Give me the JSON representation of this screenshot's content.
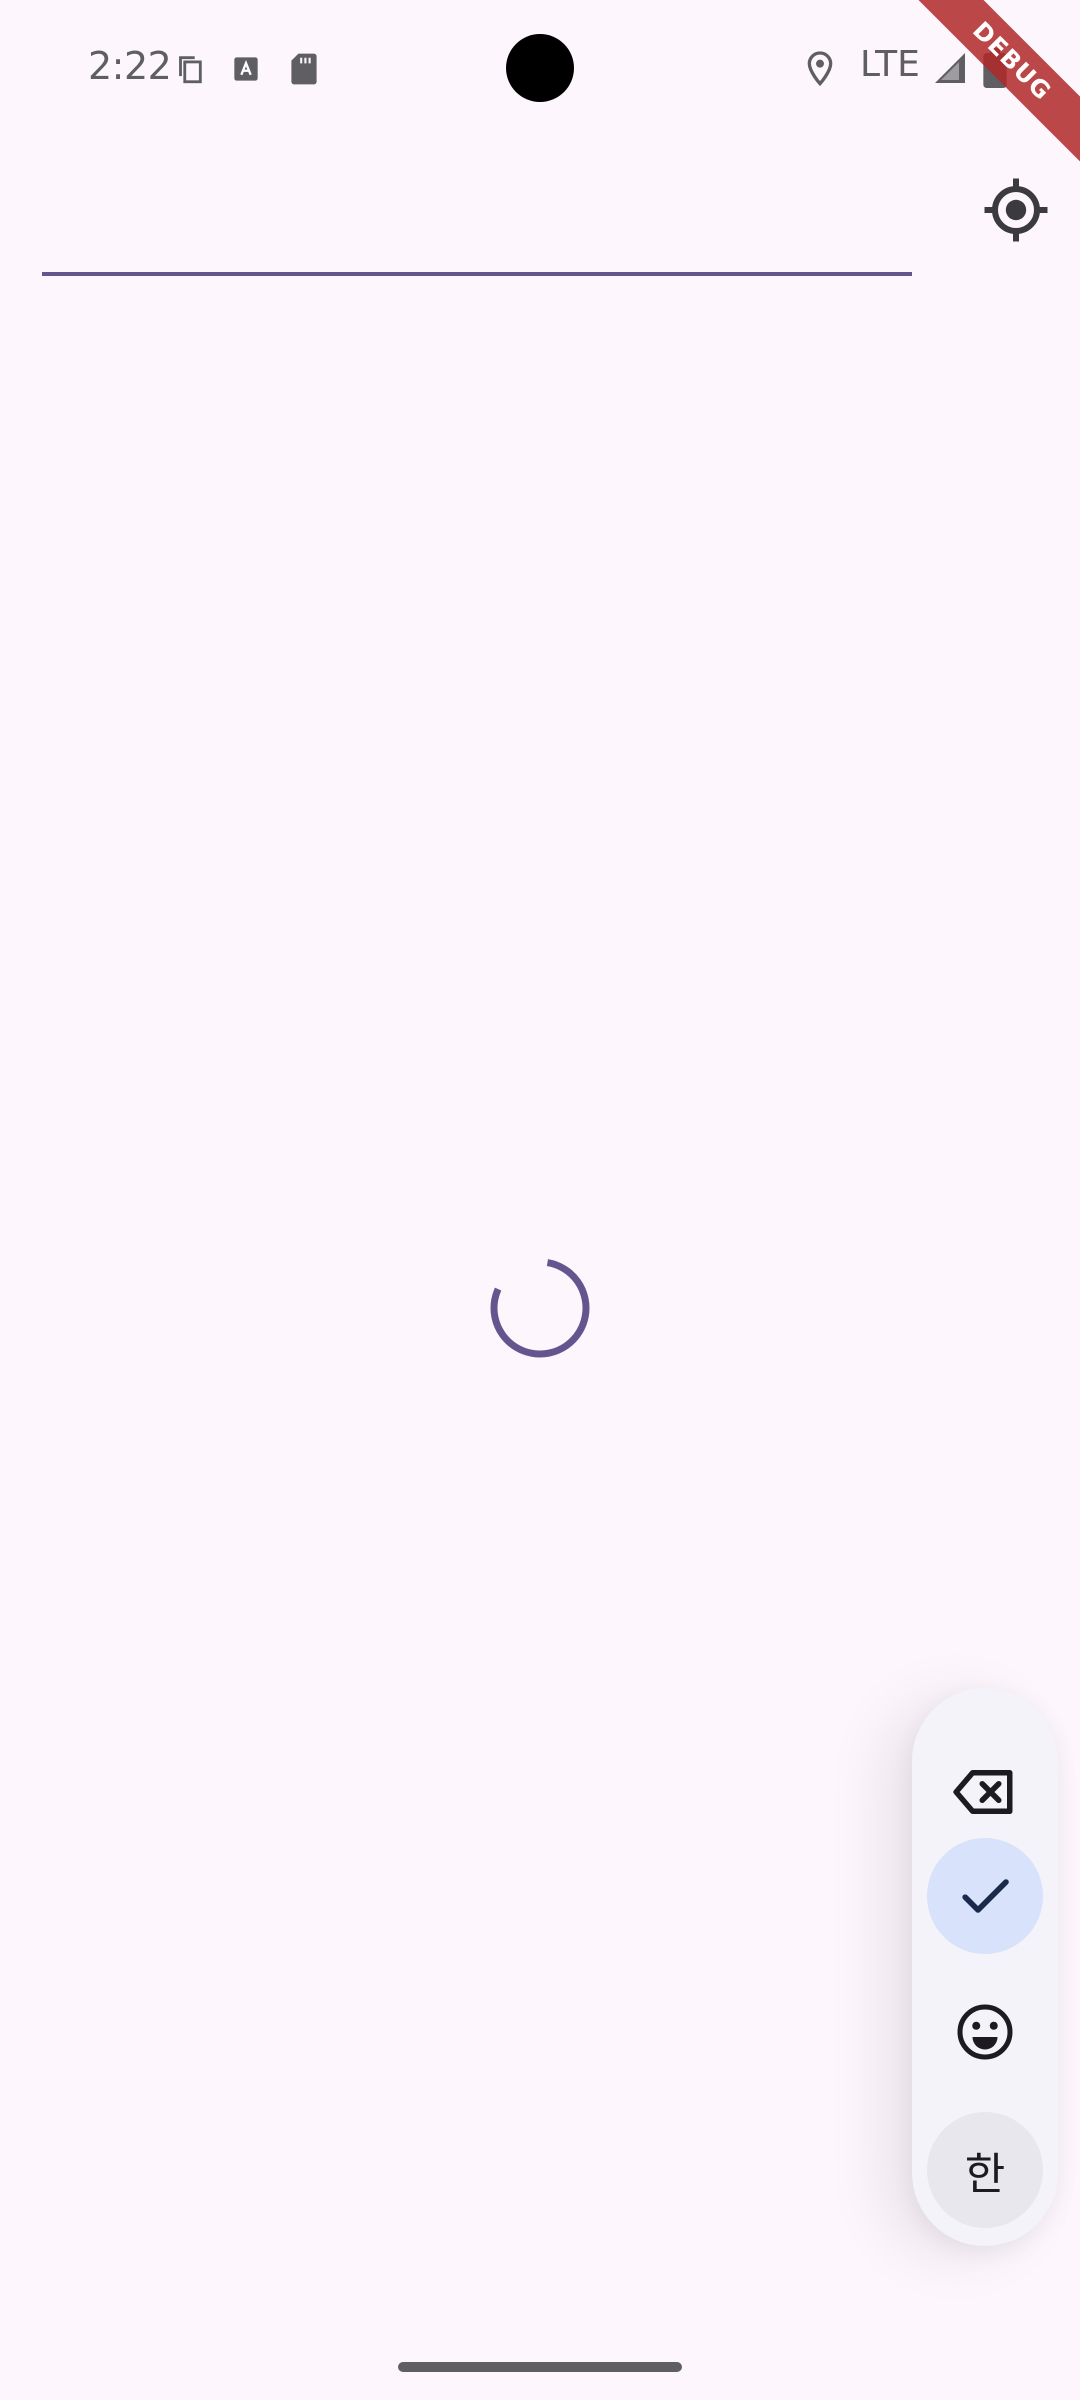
{
  "status_bar": {
    "time": "2:22",
    "network": "LTE",
    "icons": [
      "copy-icon",
      "font-a-icon",
      "sd-card-icon",
      "location-pin-icon",
      "signal-icon",
      "battery-icon"
    ]
  },
  "debug_banner": "DEBUG",
  "search": {
    "value": "",
    "placeholder": "",
    "underline_color": "#65558f"
  },
  "actions": {
    "locate_icon": "my-location-icon"
  },
  "loading": {
    "indicator": "circular-progress-spinner",
    "color": "#65558f"
  },
  "keyboard_toolbar": {
    "items": [
      {
        "icon": "backspace-icon"
      },
      {
        "icon": "check-icon",
        "selected": true
      },
      {
        "icon": "emoji-icon"
      },
      {
        "label": "한"
      }
    ],
    "accent": "#d8e2fb"
  },
  "theme": {
    "background": "#fdf7fd",
    "primary": "#65558f"
  }
}
